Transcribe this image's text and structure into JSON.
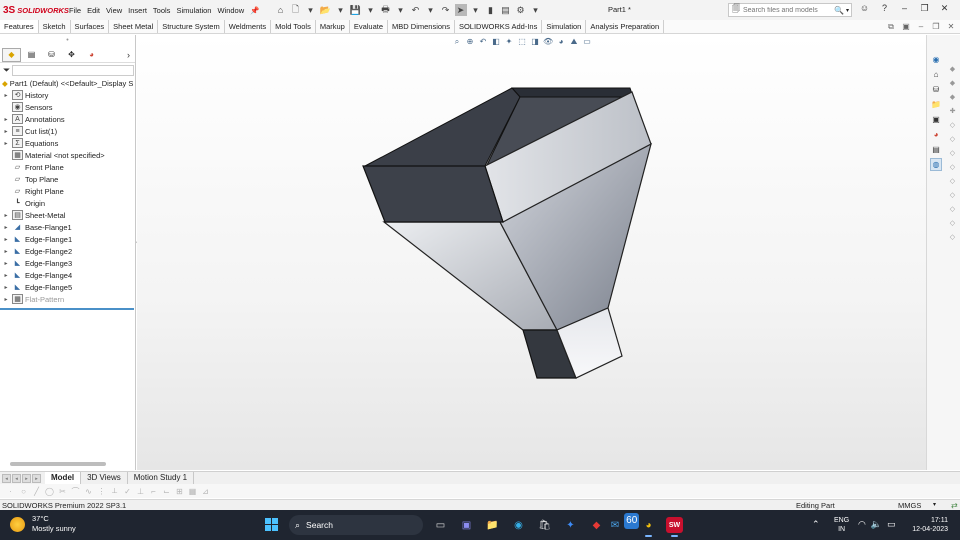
{
  "app": {
    "logo_mark": "3S",
    "logo_text": "SOLIDWORKS",
    "menu": [
      "File",
      "Edit",
      "View",
      "Insert",
      "Tools",
      "Simulation",
      "Window"
    ],
    "document_title": "Part1 *",
    "search_placeholder": "Search files and models"
  },
  "command_tabs": [
    "Features",
    "Sketch",
    "Surfaces",
    "Sheet Metal",
    "Structure System",
    "Weldments",
    "Mold Tools",
    "Markup",
    "Evaluate",
    "MBD Dimensions",
    "SOLIDWORKS Add-Ins",
    "Simulation",
    "Analysis Preparation"
  ],
  "feature_tree": {
    "root": "Part1 (Default) <<Default>_Display S",
    "items": [
      {
        "label": "History",
        "icon": "history-icon",
        "glyph": "⟲",
        "expandable": true
      },
      {
        "label": "Sensors",
        "icon": "sensor-icon",
        "glyph": "◉",
        "expandable": false
      },
      {
        "label": "Annotations",
        "icon": "annotation-icon",
        "glyph": "A",
        "expandable": true
      },
      {
        "label": "Cut list(1)",
        "icon": "cut-list-icon",
        "glyph": "≡",
        "expandable": true
      },
      {
        "label": "Equations",
        "icon": "equation-icon",
        "glyph": "Σ",
        "expandable": true
      },
      {
        "label": "Material <not specified>",
        "icon": "material-icon",
        "glyph": "▦",
        "expandable": false
      },
      {
        "label": "Front Plane",
        "icon": "plane-icon",
        "glyph": "▱",
        "expandable": false
      },
      {
        "label": "Top Plane",
        "icon": "plane-icon",
        "glyph": "▱",
        "expandable": false
      },
      {
        "label": "Right Plane",
        "icon": "plane-icon",
        "glyph": "▱",
        "expandable": false
      },
      {
        "label": "Origin",
        "icon": "origin-icon",
        "glyph": "┗",
        "expandable": false
      },
      {
        "label": "Sheet-Metal",
        "icon": "sheet-metal-icon",
        "glyph": "▤",
        "expandable": true
      },
      {
        "label": "Base-Flange1",
        "icon": "base-flange-icon",
        "glyph": "◢",
        "expandable": true
      },
      {
        "label": "Edge-Flange1",
        "icon": "edge-flange-icon",
        "glyph": "◣",
        "expandable": true
      },
      {
        "label": "Edge-Flange2",
        "icon": "edge-flange-icon",
        "glyph": "◣",
        "expandable": true
      },
      {
        "label": "Edge-Flange3",
        "icon": "edge-flange-icon",
        "glyph": "◣",
        "expandable": true
      },
      {
        "label": "Edge-Flange4",
        "icon": "edge-flange-icon",
        "glyph": "◣",
        "expandable": true
      },
      {
        "label": "Edge-Flange5",
        "icon": "edge-flange-icon",
        "glyph": "◣",
        "expandable": true
      },
      {
        "label": "Flat-Pattern",
        "icon": "flat-pattern-icon",
        "glyph": "▦",
        "expandable": true,
        "suppressed": true
      }
    ]
  },
  "bottom_tabs": [
    "Model",
    "3D Views",
    "Motion Study 1"
  ],
  "status": {
    "product": "SOLIDWORKS Premium 2022 SP3.1",
    "mode": "Editing Part",
    "units": "MMGS"
  },
  "taskbar": {
    "temperature": "37°C",
    "condition": "Mostly sunny",
    "search_label": "Search",
    "mail_badge": "60",
    "lang_1": "ENG",
    "lang_2": "IN",
    "time": "17:11",
    "date": "12-04-2023"
  },
  "colors": {
    "brand_red": "#d0021b",
    "accent_blue": "#4a90c8",
    "taskbar_bg": "#1f2530"
  }
}
